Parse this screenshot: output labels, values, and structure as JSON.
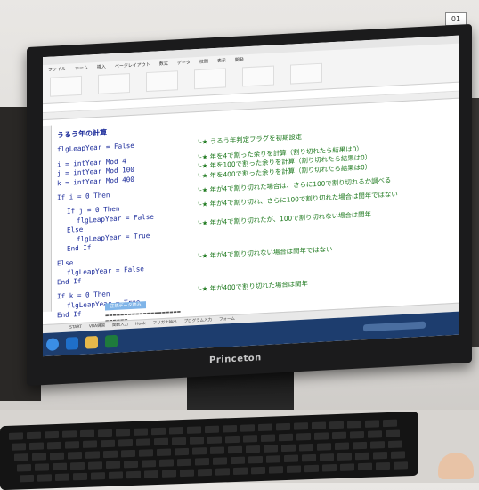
{
  "photo": {
    "badge": "01",
    "brand": "Princeton"
  },
  "excel": {
    "title": "",
    "tabs": [
      "ファイル",
      "ホーム",
      "挿入",
      "ページレイアウト",
      "数式",
      "データ",
      "校閲",
      "表示",
      "開発"
    ],
    "sheet_button": "正規データ読み",
    "sheet_tabs": [
      "START",
      "VBA練習",
      "関数入力",
      "Hook",
      "フリガナ抽出",
      "プログラム入力",
      "フォーム"
    ]
  },
  "vba": {
    "title": "うるう年の計算",
    "lines": [
      {
        "indent": 0,
        "code": "flgLeapYear = False",
        "comment": "'-★ うるう年判定フラグを初期設定"
      },
      {
        "gap": true
      },
      {
        "indent": 0,
        "code": "i = intYear Mod 4",
        "comment": "'-★ 年を4で割った余りを計算（割り切れたら結果は0）"
      },
      {
        "indent": 0,
        "code": "j = intYear Mod 100",
        "comment": "'-★ 年を100で割った余りを計算（割り切れたら結果は0）"
      },
      {
        "indent": 0,
        "code": "k = intYear Mod 400",
        "comment": "'-★ 年を400で割った余りを計算（割り切れたら結果は0）"
      },
      {
        "gap": true
      },
      {
        "indent": 0,
        "code": "If i = 0 Then",
        "comment": "'-★ 年が4で割り切れた場合は、さらに100で割り切れるか調べる"
      },
      {
        "gap": true
      },
      {
        "indent": 2,
        "code": "If j = 0 Then",
        "comment": "'-★ 年が4で割り切れ、さらに100で割り切れた場合は閏年ではない"
      },
      {
        "indent": 4,
        "code": "flgLeapYear = False",
        "comment": ""
      },
      {
        "indent": 2,
        "code": "Else",
        "comment": "'-★ 年が4で割り切れたが、100で割り切れない場合は閏年"
      },
      {
        "indent": 4,
        "code": "flgLeapYear = True",
        "comment": ""
      },
      {
        "indent": 2,
        "code": "End If",
        "comment": ""
      },
      {
        "gap": true
      },
      {
        "indent": 0,
        "code": "Else",
        "comment": "'-★ 年が4で割り切れない場合は閏年ではない"
      },
      {
        "indent": 2,
        "code": "flgLeapYear = False",
        "comment": ""
      },
      {
        "indent": 0,
        "code": "End If",
        "comment": ""
      },
      {
        "gap": true
      },
      {
        "indent": 0,
        "code": "If k = 0 Then",
        "comment": "'-★ 年が400で割り切れた場合は閏年"
      },
      {
        "indent": 2,
        "code": "flgLeapYear = True",
        "comment": ""
      },
      {
        "indent": 0,
        "code": "End If",
        "comment": ""
      }
    ]
  },
  "colors": {
    "code": "#1a2a9a",
    "comment": "#1f7a1f",
    "taskbar": "#1d3d6e"
  }
}
